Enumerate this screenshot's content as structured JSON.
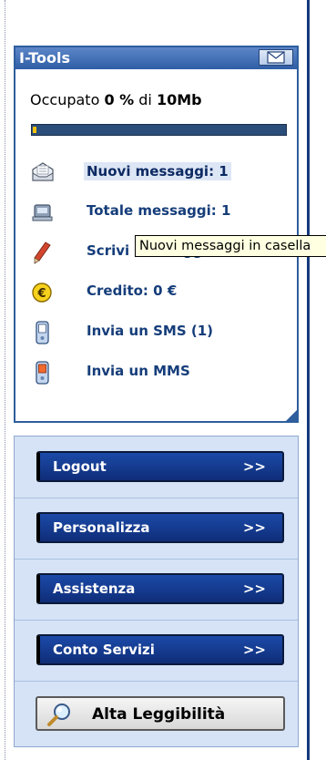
{
  "panel": {
    "title": "I-Tools",
    "usage_prefix": "Occupato ",
    "usage_percent": "0 %",
    "usage_mid": " di ",
    "usage_total": "10Mb",
    "usage_fraction": 0,
    "items": [
      {
        "label": "Nuovi messaggi: 1",
        "icon": "inbox-icon"
      },
      {
        "label": "Totale messaggi: 1",
        "icon": "messages-icon"
      },
      {
        "label": "Scrivi messaggio",
        "icon": "pencil-icon"
      },
      {
        "label": "Credito: 0 €",
        "icon": "euro-coin-icon"
      },
      {
        "label": "Invia un SMS (1)",
        "icon": "phone-sms-icon"
      },
      {
        "label": "Invia un MMS",
        "icon": "phone-mms-icon"
      }
    ]
  },
  "tooltip": "Nuovi messaggi in casella",
  "buttons": {
    "logout": "Logout",
    "personalizza": "Personalizza",
    "assistenza": "Assistenza",
    "conto": "Conto Servizi",
    "arrow": ">>",
    "alta": "Alta Leggibilità"
  },
  "colors": {
    "panel_border": "#2f5e9d",
    "button_blue": "#1b4aa8",
    "label_blue": "#153d7a",
    "progress_fill": "#f4c20d"
  }
}
